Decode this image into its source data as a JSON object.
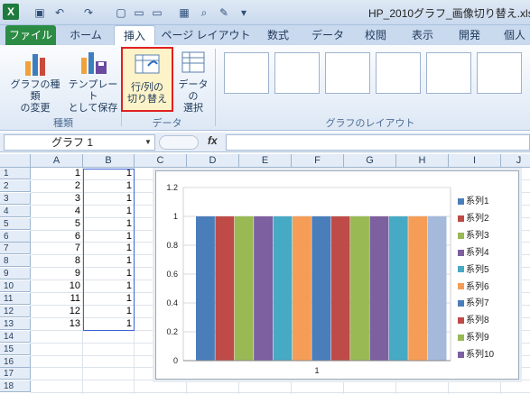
{
  "titlebar": {
    "title": "HP_2010グラフ_画像切り替え.xls"
  },
  "tabs": [
    "ファイル",
    "ホーム",
    "挿入",
    "ページ レイアウト",
    "数式",
    "データ",
    "校閲",
    "表示",
    "開発",
    "個人"
  ],
  "ribbon": {
    "change_type": "グラフの種類\nの変更",
    "save_template": "テンプレート\nとして保存",
    "switch_row_col": "行/列の\n切り替え",
    "select_data": "データの\n選択",
    "group_type": "種類",
    "group_data": "データ",
    "group_layout": "グラフのレイアウト"
  },
  "formula_bar": {
    "name_box": "グラフ 1",
    "fx": "fx"
  },
  "sheet": {
    "columns": [
      "A",
      "B",
      "C",
      "D",
      "E",
      "F",
      "G",
      "H",
      "I",
      "J"
    ],
    "rows": [
      "1",
      "2",
      "3",
      "4",
      "5",
      "6",
      "7",
      "8",
      "9",
      "10",
      "11",
      "12",
      "13",
      "14",
      "15",
      "16",
      "17",
      "18"
    ],
    "col_a": [
      "1",
      "2",
      "3",
      "4",
      "5",
      "6",
      "7",
      "8",
      "9",
      "10",
      "11",
      "12",
      "13"
    ],
    "col_b": [
      "1",
      "1",
      "1",
      "1",
      "1",
      "1",
      "1",
      "1",
      "1",
      "1",
      "1",
      "1",
      "1"
    ]
  },
  "chart_data": {
    "type": "bar",
    "categories": [
      "1"
    ],
    "series": [
      {
        "name": "系列1",
        "values": [
          1
        ]
      },
      {
        "name": "系列2",
        "values": [
          1
        ]
      },
      {
        "name": "系列3",
        "values": [
          1
        ]
      },
      {
        "name": "系列4",
        "values": [
          1
        ]
      },
      {
        "name": "系列5",
        "values": [
          1
        ]
      },
      {
        "name": "系列6",
        "values": [
          1
        ]
      },
      {
        "name": "系列7",
        "values": [
          1
        ]
      },
      {
        "name": "系列8",
        "values": [
          1
        ]
      },
      {
        "name": "系列9",
        "values": [
          1
        ]
      },
      {
        "name": "系列10",
        "values": [
          1
        ]
      },
      {
        "values": [
          1
        ]
      },
      {
        "values": [
          1
        ]
      },
      {
        "values": [
          1
        ]
      }
    ],
    "colors": [
      "#4a7ebb",
      "#be4b48",
      "#98b954",
      "#7d60a0",
      "#46aac5",
      "#f59d56",
      "#4a7ebb",
      "#be4b48",
      "#98b954",
      "#7d60a0",
      "#46aac5",
      "#f59d56",
      "#a5b9db"
    ],
    "yticks": [
      "0",
      "0.2",
      "0.4",
      "0.6",
      "0.8",
      "1",
      "1.2"
    ],
    "ylim": [
      0,
      1.2
    ],
    "legend": "right",
    "grid": true
  }
}
